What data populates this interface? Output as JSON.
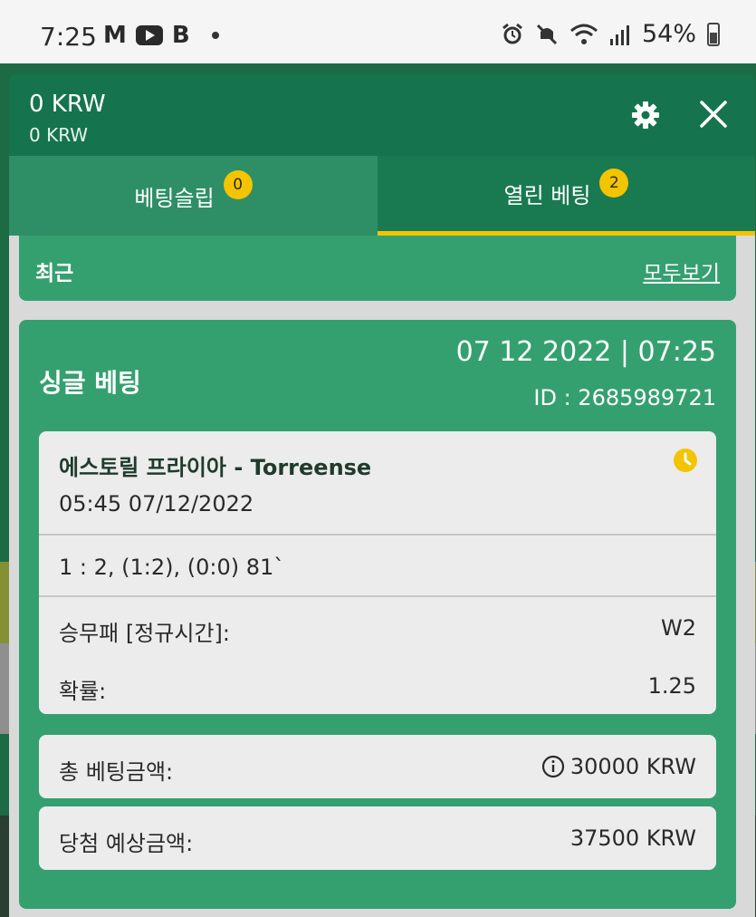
{
  "status_bar": {
    "time": "7:25",
    "app_letters": [
      "M",
      "B"
    ],
    "battery": "54%"
  },
  "header": {
    "balance": "0 KRW",
    "balance_sub": "0 KRW"
  },
  "tabs": [
    {
      "label": "베팅슬립",
      "count": "0",
      "active": false
    },
    {
      "label": "열린 베팅",
      "count": "2",
      "active": true
    }
  ],
  "recent": {
    "title": "최근",
    "see_all": "모두보기"
  },
  "bet": {
    "type": "싱글 베팅",
    "date": "07 12 2022 | 07:25",
    "id": "ID : 2685989721",
    "event_title": "에스토릴 프라이아 - Torreense",
    "event_time": "05:45   07/12/2022",
    "score": "1 : 2, (1:2), (0:0) 81`",
    "market_label": "승무패 [정규시간]:",
    "market_value": "W2",
    "odds_label": "확률:",
    "odds_value": "1.25",
    "total_label": "총 베팅금액:",
    "total_value": "30000 KRW",
    "payout_label": "당첨 예상금액:",
    "payout_value": "37500 KRW"
  },
  "colors": {
    "header": "#15744d",
    "card": "#35a06f",
    "accent": "#f3c400"
  }
}
